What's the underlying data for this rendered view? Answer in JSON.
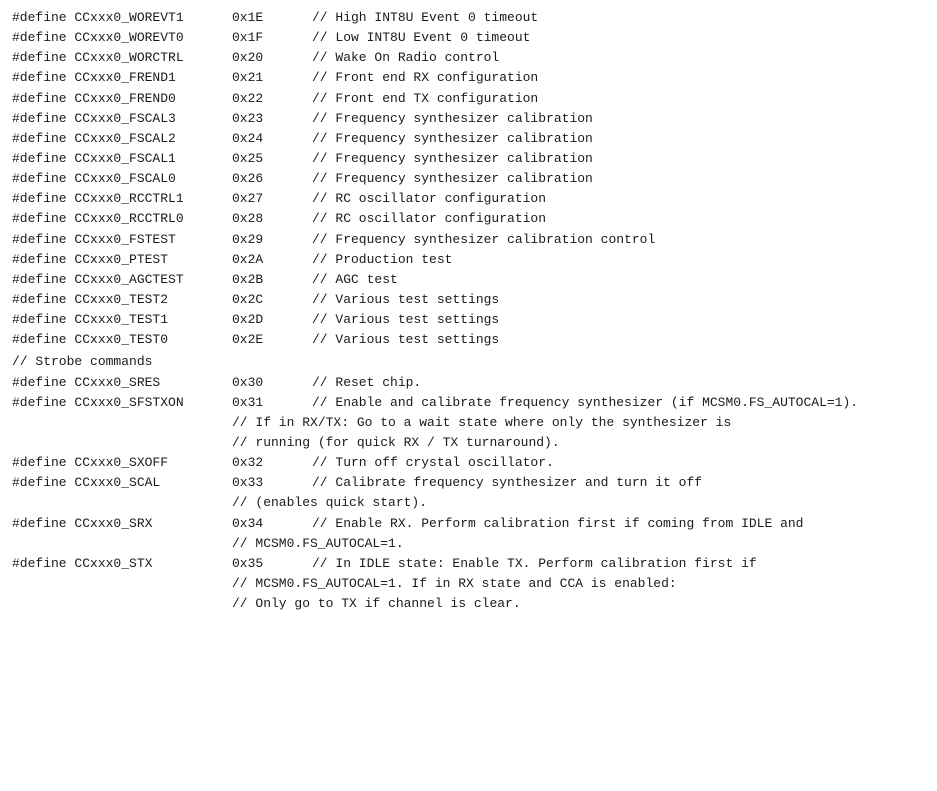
{
  "lines": [
    {
      "define": "#define CCxxx0_WOREVT1",
      "value": "0x1E",
      "comment": "// High INT8U Event 0 timeout"
    },
    {
      "define": "#define CCxxx0_WOREVT0",
      "value": "0x1F",
      "comment": "// Low INT8U Event 0 timeout"
    },
    {
      "define": "#define CCxxx0_WORCTRL",
      "value": "0x20",
      "comment": "// Wake On Radio control"
    },
    {
      "define": "#define CCxxx0_FREND1",
      "value": "0x21",
      "comment": "// Front end RX configuration"
    },
    {
      "define": "#define CCxxx0_FREND0",
      "value": "0x22",
      "comment": "// Front end TX configuration"
    },
    {
      "define": "#define CCxxx0_FSCAL3",
      "value": "0x23",
      "comment": "// Frequency synthesizer calibration"
    },
    {
      "define": "#define CCxxx0_FSCAL2",
      "value": "0x24",
      "comment": "// Frequency synthesizer calibration"
    },
    {
      "define": "#define CCxxx0_FSCAL1",
      "value": "0x25",
      "comment": "// Frequency synthesizer calibration"
    },
    {
      "define": "#define CCxxx0_FSCAL0",
      "value": "0x26",
      "comment": "// Frequency synthesizer calibration"
    },
    {
      "define": "#define CCxxx0_RCCTRL1",
      "value": "0x27",
      "comment": "// RC oscillator configuration"
    },
    {
      "define": "#define CCxxx0_RCCTRL0",
      "value": "0x28",
      "comment": "// RC oscillator configuration"
    },
    {
      "define": "#define CCxxx0_FSTEST",
      "value": "0x29",
      "comment": "// Frequency synthesizer calibration control"
    },
    {
      "define": "#define CCxxx0_PTEST",
      "value": "0x2A",
      "comment": "// Production test"
    },
    {
      "define": "#define CCxxx0_AGCTEST",
      "value": "0x2B",
      "comment": "// AGC test"
    },
    {
      "define": "#define CCxxx0_TEST2",
      "value": "0x2C",
      "comment": "// Various test settings"
    },
    {
      "define": "#define CCxxx0_TEST1",
      "value": "0x2D",
      "comment": "// Various test settings"
    },
    {
      "define": "#define CCxxx0_TEST0",
      "value": "0x2E",
      "comment": "// Various test settings"
    }
  ],
  "section_strobe": "// Strobe commands",
  "strobe_lines": [
    {
      "type": "simple",
      "define": "#define CCxxx0_SRES",
      "value": "0x30",
      "comment": "// Reset chip."
    },
    {
      "type": "multi",
      "define": "#define CCxxx0_SFSTXON",
      "value": "0x31",
      "comment": "// Enable and calibrate frequency synthesizer (if MCSM0.FS_AUTOCAL=1).",
      "continuation": [
        "// If in RX/TX: Go to a wait state where only the synthesizer is",
        "// running (for quick RX / TX turnaround)."
      ]
    },
    {
      "type": "simple",
      "define": "#define CCxxx0_SXOFF",
      "value": "0x32",
      "comment": "// Turn off crystal oscillator."
    },
    {
      "type": "multi",
      "define": "#define CCxxx0_SCAL",
      "value": "0x33",
      "comment": "// Calibrate frequency synthesizer and turn it off",
      "continuation": [
        "// (enables quick start)."
      ]
    },
    {
      "type": "multi",
      "define": "#define CCxxx0_SRX",
      "value": "0x34",
      "comment": "// Enable RX. Perform calibration first if coming from IDLE and",
      "continuation": [
        "// MCSM0.FS_AUTOCAL=1."
      ]
    },
    {
      "type": "multi",
      "define": "#define CCxxx0_STX",
      "value": "0x35",
      "comment": "// In IDLE state: Enable TX. Perform calibration first if",
      "continuation": [
        "// MCSM0.FS_AUTOCAL=1. If in RX state and CCA is enabled:",
        "// Only go to TX if channel is clear."
      ]
    }
  ]
}
